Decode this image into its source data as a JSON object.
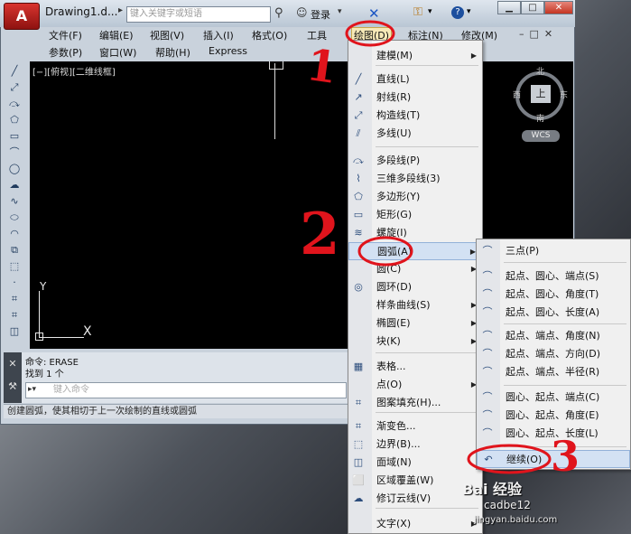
{
  "window": {
    "doc_title": "Drawing1.d...",
    "search_placeholder": "键入关键字或短语",
    "login": "登录",
    "help": "?",
    "min": "▁",
    "max": "□",
    "close": "✕"
  },
  "menubar": {
    "row1": [
      "文件(F)",
      "编辑(E)",
      "视图(V)",
      "插入(I)",
      "格式(O)",
      "工具",
      "绘图(D)",
      "标注(N)",
      "修改(M)"
    ],
    "row2": [
      "参数(P)",
      "窗口(W)",
      "帮助(H)",
      "Express"
    ]
  },
  "canvas": {
    "view_label": "[−][俯视][二维线框]",
    "ucs_x": "X",
    "ucs_y": "Y"
  },
  "viewcube": {
    "top": "上",
    "north": "北",
    "south": "南",
    "east": "东",
    "west": "西",
    "wcs": "WCS"
  },
  "command": {
    "line1": "命令:  ERASE",
    "line2": "找到 1 个",
    "placeholder": "键入命令",
    "status": "创建圆弧，使其相切于上一次绘制的直线或圆弧"
  },
  "draw_menu": [
    {
      "label": "建模(M)",
      "icon": "",
      "sub": true
    },
    {
      "label": "直线(L)",
      "icon": "╱"
    },
    {
      "label": "射线(R)",
      "icon": "↗"
    },
    {
      "label": "构造线(T)",
      "icon": "⤢"
    },
    {
      "label": "多线(U)",
      "icon": "⫽"
    },
    {
      "label": "多段线(P)",
      "icon": "⤼"
    },
    {
      "label": "三维多段线(3)",
      "icon": "⌇"
    },
    {
      "label": "多边形(Y)",
      "icon": "⬠"
    },
    {
      "label": "矩形(G)",
      "icon": "▭"
    },
    {
      "label": "螺旋(I)",
      "icon": "≋"
    },
    {
      "label": "圆弧(A)",
      "icon": "",
      "sub": true
    },
    {
      "label": "圆(C)",
      "icon": "",
      "sub": true
    },
    {
      "label": "圆环(D)",
      "icon": "◎"
    },
    {
      "label": "样条曲线(S)",
      "icon": "",
      "sub": true
    },
    {
      "label": "椭圆(E)",
      "icon": "",
      "sub": true
    },
    {
      "label": "块(K)",
      "icon": "",
      "sub": true
    },
    {
      "label": "表格...",
      "icon": "▦"
    },
    {
      "label": "点(O)",
      "icon": "",
      "sub": true
    },
    {
      "label": "图案填充(H)...",
      "icon": "⌗"
    },
    {
      "label": "渐变色...",
      "icon": "⌗"
    },
    {
      "label": "边界(B)...",
      "icon": "⬚"
    },
    {
      "label": "面域(N)",
      "icon": "◫"
    },
    {
      "label": "区域覆盖(W)",
      "icon": "⬜"
    },
    {
      "label": "修订云线(V)",
      "icon": "☁"
    },
    {
      "label": "文字(X)",
      "icon": "",
      "sub": true
    }
  ],
  "arc_menu": [
    {
      "label": "三点(P)",
      "icon": "⌒"
    },
    {
      "label": "起点、圆心、端点(S)",
      "icon": "⌒"
    },
    {
      "label": "起点、圆心、角度(T)",
      "icon": "⌒"
    },
    {
      "label": "起点、圆心、长度(A)",
      "icon": "⌒"
    },
    {
      "label": "起点、端点、角度(N)",
      "icon": "⌒"
    },
    {
      "label": "起点、端点、方向(D)",
      "icon": "⌒"
    },
    {
      "label": "起点、端点、半径(R)",
      "icon": "⌒"
    },
    {
      "label": "圆心、起点、端点(C)",
      "icon": "⌒"
    },
    {
      "label": "圆心、起点、角度(E)",
      "icon": "⌒"
    },
    {
      "label": "圆心、起点、长度(L)",
      "icon": "⌒"
    },
    {
      "label": "继续(O)",
      "icon": "↶"
    }
  ],
  "annotations": {
    "one": "1",
    "two": "2",
    "three": "3"
  },
  "watermark": {
    "line1": "Bai 经验",
    "line2": "cadbe12",
    "line3": "jingyan.baidu.com"
  },
  "colors": {
    "annotation": "#e0141c",
    "highlight": "#d3e1f3",
    "canvas": "#000000",
    "app_red": "#c8221d"
  }
}
